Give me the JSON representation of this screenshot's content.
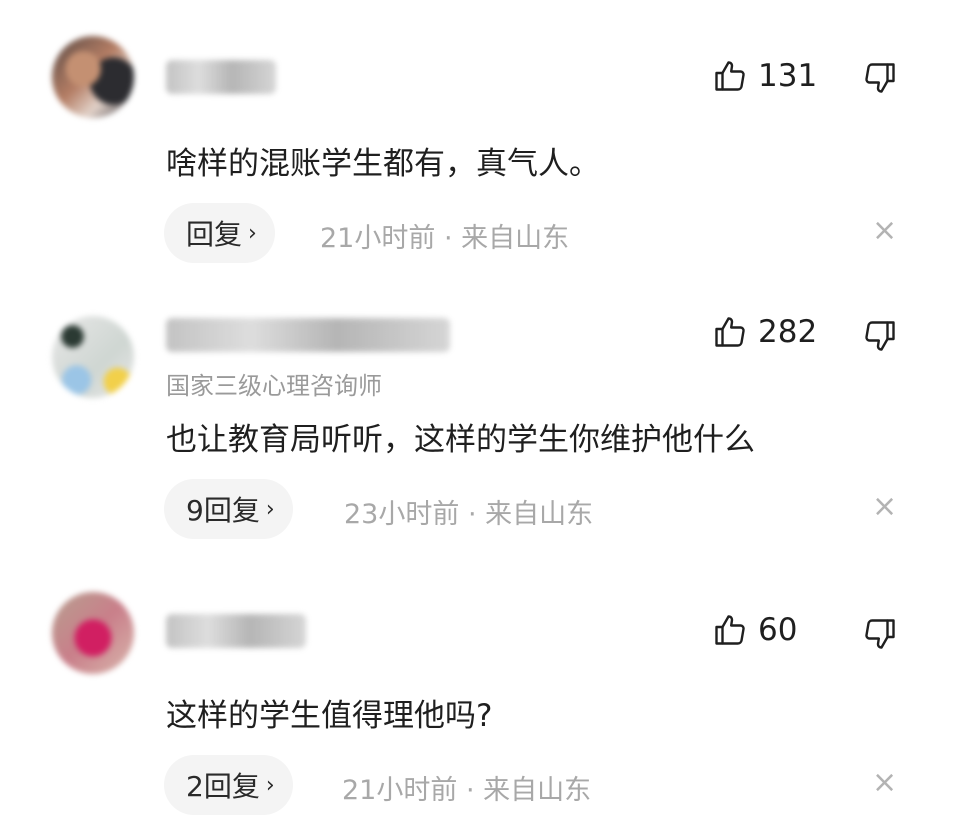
{
  "comments": [
    {
      "text": "啥样的混账学生都有，真气人。",
      "likes": "131",
      "reply_label": "回复",
      "time": "21小时前",
      "separator": "·",
      "location": "来自山东"
    },
    {
      "title": "国家三级心理咨询师",
      "text": "也让教育局听听，这样的学生你维护他什么",
      "likes": "282",
      "reply_label": "9回复",
      "time": "23小时前",
      "separator": "·",
      "location": "来自山东"
    },
    {
      "text": "这样的学生值得理他吗?",
      "likes": "60",
      "reply_label": "2回复",
      "time": "21小时前",
      "separator": "·",
      "location": "来自山东"
    }
  ],
  "icons": {
    "like": "thumbs-up-icon",
    "dislike": "thumbs-down-icon",
    "reply_chevron": "chevron-right-icon",
    "close": "close-icon"
  },
  "glyphs": {
    "chevron": "›",
    "close": "×"
  }
}
